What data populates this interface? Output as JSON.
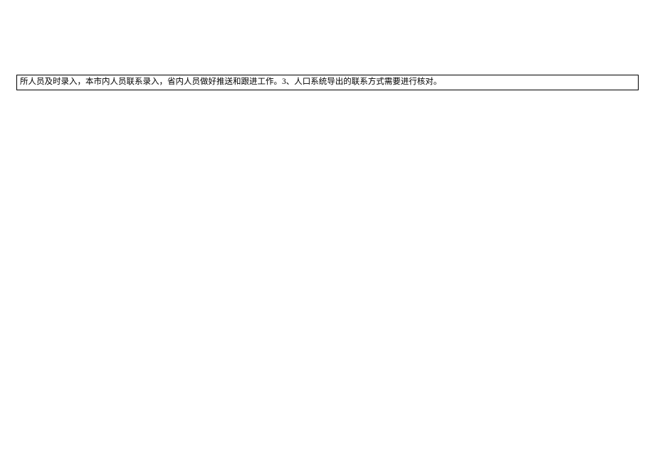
{
  "document": {
    "body_text": "所人员及时录入，本市内人员联系录入，省内人员做好推送和跟进工作。3、人口系统导出的联系方式需要进行核对。"
  }
}
